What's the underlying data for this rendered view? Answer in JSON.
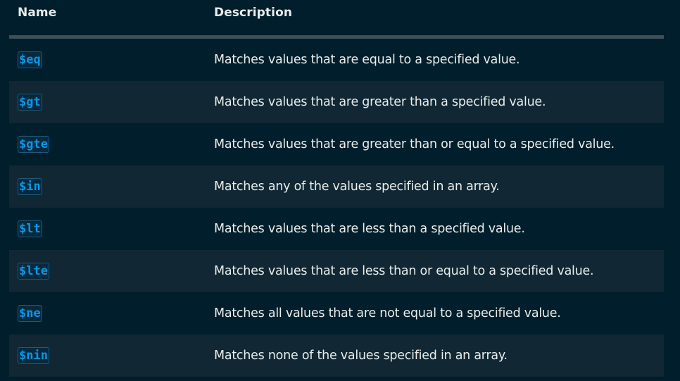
{
  "table": {
    "headers": {
      "name": "Name",
      "description": "Description"
    },
    "rows": [
      {
        "operator": "$eq",
        "description": "Matches values that are equal to a specified value."
      },
      {
        "operator": "$gt",
        "description": "Matches values that are greater than a specified value."
      },
      {
        "operator": "$gte",
        "description": "Matches values that are greater than or equal to a specified value."
      },
      {
        "operator": "$in",
        "description": "Matches any of the values specified in an array."
      },
      {
        "operator": "$lt",
        "description": "Matches values that are less than a specified value."
      },
      {
        "operator": "$lte",
        "description": "Matches values that are less than or equal to a specified value."
      },
      {
        "operator": "$ne",
        "description": "Matches all values that are not equal to a specified value."
      },
      {
        "operator": "$nin",
        "description": "Matches none of the values specified in an array."
      }
    ]
  },
  "colors": {
    "background": "#001e2b",
    "alt_row": "#112733",
    "header_divider": "#3d4f58",
    "code_text": "#0498ec",
    "body_text": "#e8edeb"
  }
}
